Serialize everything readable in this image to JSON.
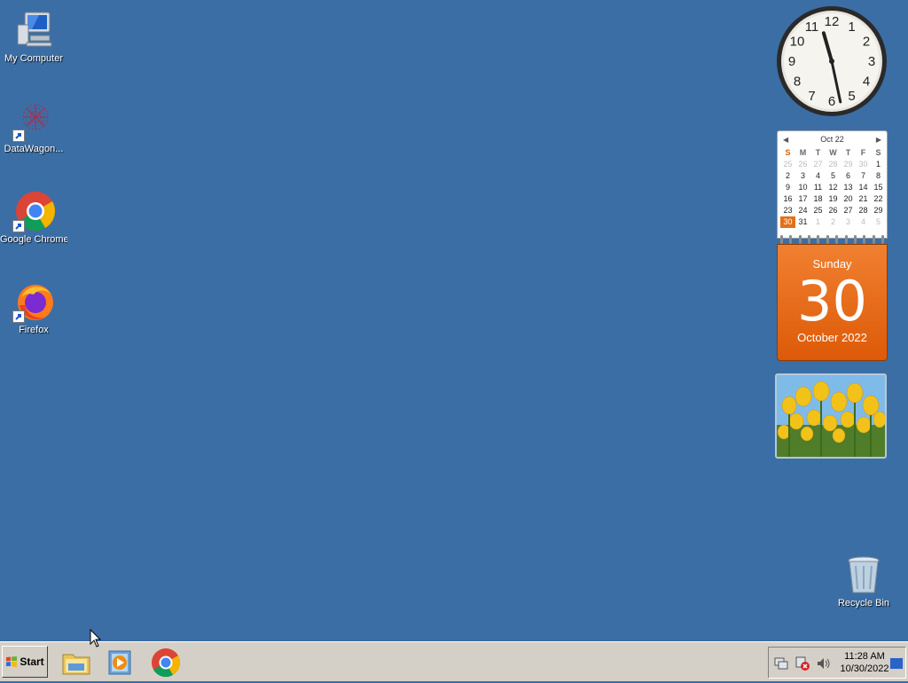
{
  "desktop": {
    "background": "#3b6ea5",
    "icons": [
      {
        "label": "My Computer",
        "icon": "my-computer-icon"
      },
      {
        "label": "DataWagon...",
        "icon": "datawagon-icon"
      },
      {
        "label": "Google Chrome",
        "icon": "chrome-icon"
      },
      {
        "label": "Firefox",
        "icon": "firefox-icon"
      },
      {
        "label": "Recycle Bin",
        "icon": "recycle-bin-icon"
      }
    ]
  },
  "gadgets": {
    "clock": {
      "numerals": [
        "12",
        "1",
        "2",
        "3",
        "4",
        "5",
        "6",
        "7",
        "8",
        "9",
        "10",
        "11"
      ],
      "time": "11:28"
    },
    "calendar": {
      "month_label": "Oct 22",
      "weekdays": [
        "S",
        "M",
        "T",
        "W",
        "T",
        "F",
        "S"
      ],
      "weeks": [
        [
          "25",
          "26",
          "27",
          "28",
          "29",
          "30",
          "1"
        ],
        [
          "2",
          "3",
          "4",
          "5",
          "6",
          "7",
          "8"
        ],
        [
          "9",
          "10",
          "11",
          "12",
          "13",
          "14",
          "15"
        ],
        [
          "16",
          "17",
          "18",
          "19",
          "20",
          "21",
          "22"
        ],
        [
          "23",
          "24",
          "25",
          "26",
          "27",
          "28",
          "29"
        ],
        [
          "30",
          "31",
          "1",
          "2",
          "3",
          "4",
          "5"
        ]
      ],
      "today": "30",
      "weekday_name": "Sunday",
      "day_number": "30",
      "month_year": "October 2022",
      "accent": "#e2701a"
    },
    "slideshow": {
      "subject": "yellow tulips photo"
    }
  },
  "taskbar": {
    "start_label": "Start",
    "pinned": [
      {
        "name": "explorer-icon"
      },
      {
        "name": "media-player-icon"
      },
      {
        "name": "chrome-icon"
      }
    ],
    "tray": {
      "time": "11:28 AM",
      "date": "10/30/2022",
      "icons": [
        "network-icon",
        "security-alert-icon",
        "volume-icon"
      ]
    }
  }
}
